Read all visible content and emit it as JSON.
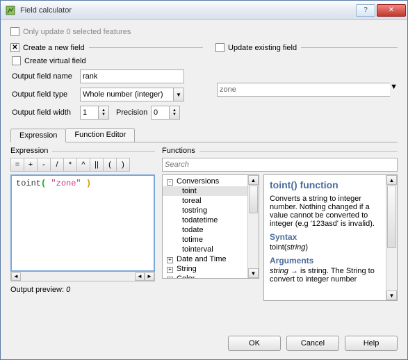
{
  "window": {
    "title": "Field calculator"
  },
  "top": {
    "only_update_label": "Only update 0 selected features",
    "create_new_label": "Create a new field",
    "update_existing_label": "Update existing field",
    "create_virtual_label": "Create virtual field",
    "out_name_label": "Output field name",
    "out_name_value": "rank",
    "out_type_label": "Output field type",
    "out_type_value": "Whole number (integer)",
    "out_width_label": "Output field width",
    "out_width_value": "1",
    "precision_label": "Precision",
    "precision_value": "0",
    "update_field_value": "zone"
  },
  "tabs": {
    "expression": "Expression",
    "func_editor": "Function Editor"
  },
  "expr": {
    "group_label": "Expression",
    "ops": [
      "=",
      "+",
      "-",
      "/",
      "*",
      "^",
      "||",
      "(",
      ")"
    ],
    "code_fn": "toint",
    "code_open": "(",
    "code_str": "\"zone\"",
    "code_close": ")",
    "preview_label": "Output preview:",
    "preview_value": "0"
  },
  "funcs": {
    "group_label": "Functions",
    "search_placeholder": "Search",
    "tree_top": "Conversions",
    "tree_items": [
      "toint",
      "toreal",
      "tostring",
      "todatetime",
      "todate",
      "totime",
      "tointerval"
    ],
    "tree_after": [
      "Date and Time",
      "String",
      "Color"
    ]
  },
  "help": {
    "title": "toint() function",
    "desc": "Converts a string to integer number. Nothing changed if a value cannot be converted to integer (e.g '123asd' is invalid).",
    "syntax_h": "Syntax",
    "syntax_txt": "toint(string)",
    "args_h": "Arguments",
    "args_txt_pre": "string",
    "args_txt_post": " → is string. The String to convert to integer number"
  },
  "buttons": {
    "ok": "OK",
    "cancel": "Cancel",
    "help": "Help"
  }
}
